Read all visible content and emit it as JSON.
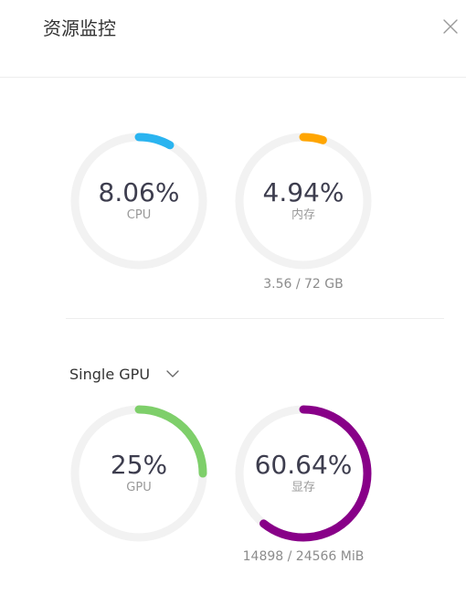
{
  "dialog": {
    "title": "资源监控"
  },
  "icons": {
    "close": "close-icon",
    "dropdown": "chevron-down-icon"
  },
  "system": {
    "cpu": {
      "percent": 8.06,
      "value_text": "8.06%",
      "label": "CPU",
      "color": "#2ab4f0"
    },
    "memory": {
      "percent": 4.94,
      "value_text": "4.94%",
      "label": "内存",
      "color": "#ffa500",
      "usage_text": "3.56 / 72 GB"
    }
  },
  "gpu": {
    "selector": {
      "selected": "Single GPU"
    },
    "util": {
      "percent": 25,
      "value_text": "25%",
      "label": "GPU",
      "color": "#7ecf6a"
    },
    "vram": {
      "percent": 60.64,
      "value_text": "60.64%",
      "label": "显存",
      "color": "#880088",
      "usage_text": "14898 / 24566 MiB"
    }
  },
  "colors": {
    "track": "#f2f2f2"
  }
}
